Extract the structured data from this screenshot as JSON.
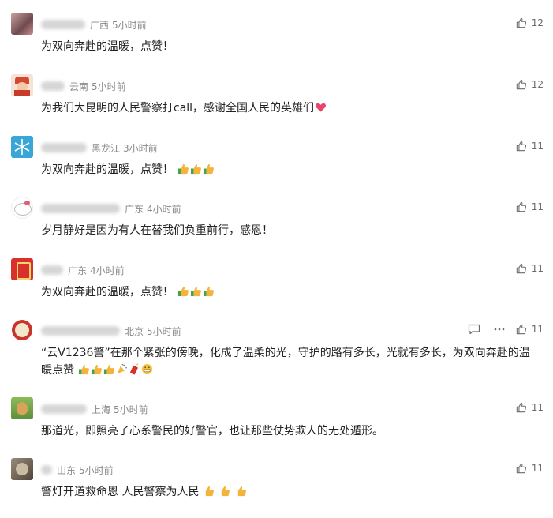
{
  "comments": [
    {
      "location": "广西",
      "time": "5小时前",
      "text": "为双向奔赴的温暖，点赞！",
      "likes": "12",
      "name_width": 56,
      "avatar": "photo-girl",
      "emojis": []
    },
    {
      "location": "云南",
      "time": "5小时前",
      "text": "为我们大昆明的人民警察打call，感谢全国人民的英雄们",
      "likes": "12",
      "name_width": 30,
      "avatar": "cartoon-red",
      "emojis": [
        "heart"
      ]
    },
    {
      "location": "黑龙江",
      "time": "3小时前",
      "text": "为双向奔赴的温暖，点赞！",
      "likes": "11",
      "name_width": 58,
      "avatar": "snowflake",
      "emojis": [
        "thumbs",
        "thumbs",
        "thumbs"
      ]
    },
    {
      "location": "广东",
      "time": "4小时前",
      "text": "岁月静好是因为有人在替我们负重前行，感恩！",
      "likes": "11",
      "name_width": 100,
      "avatar": "kitty",
      "emojis": []
    },
    {
      "location": "广东",
      "time": "4小时前",
      "text": "为双向奔赴的温暖，点赞！",
      "likes": "11",
      "name_width": 28,
      "avatar": "red-char",
      "emojis": [
        "thumbs",
        "thumbs",
        "thumbs"
      ]
    },
    {
      "location": "北京",
      "time": "5小时前",
      "text": "“云V1236警”在那个紧张的傍晚，化成了温柔的光，守护的路有多长，光就有多长，为双向奔赴的温暖点赞",
      "likes": "11",
      "name_width": 100,
      "avatar": "red-badge",
      "emojis": [
        "thumbs",
        "thumbs",
        "thumbs",
        "party",
        "firecracker",
        "grin"
      ],
      "show_actions": true
    },
    {
      "location": "上海",
      "time": "5小时前",
      "text": "那道光，即照亮了心系警民的好警官，也让那些仗势欺人的无处遁形。",
      "likes": "11",
      "name_width": 58,
      "avatar": "dog",
      "emojis": []
    },
    {
      "location": "山东",
      "time": "5小时前",
      "text": "警灯开道救命恩 人民警察为人民",
      "likes": "11",
      "name_width": 14,
      "avatar": "cat",
      "emojis": [
        "thumbs-plain",
        "thumbs-plain",
        "thumbs-plain"
      ]
    }
  ],
  "icons": {
    "like": "thumbs-up-icon",
    "reply": "comment-icon",
    "more": "more-dots-icon"
  },
  "colors": {
    "meta": "#8a8a8a",
    "text": "#222222",
    "thumb_yellow": "#f4b43b",
    "thumb_sleeve": "#49a14b"
  }
}
